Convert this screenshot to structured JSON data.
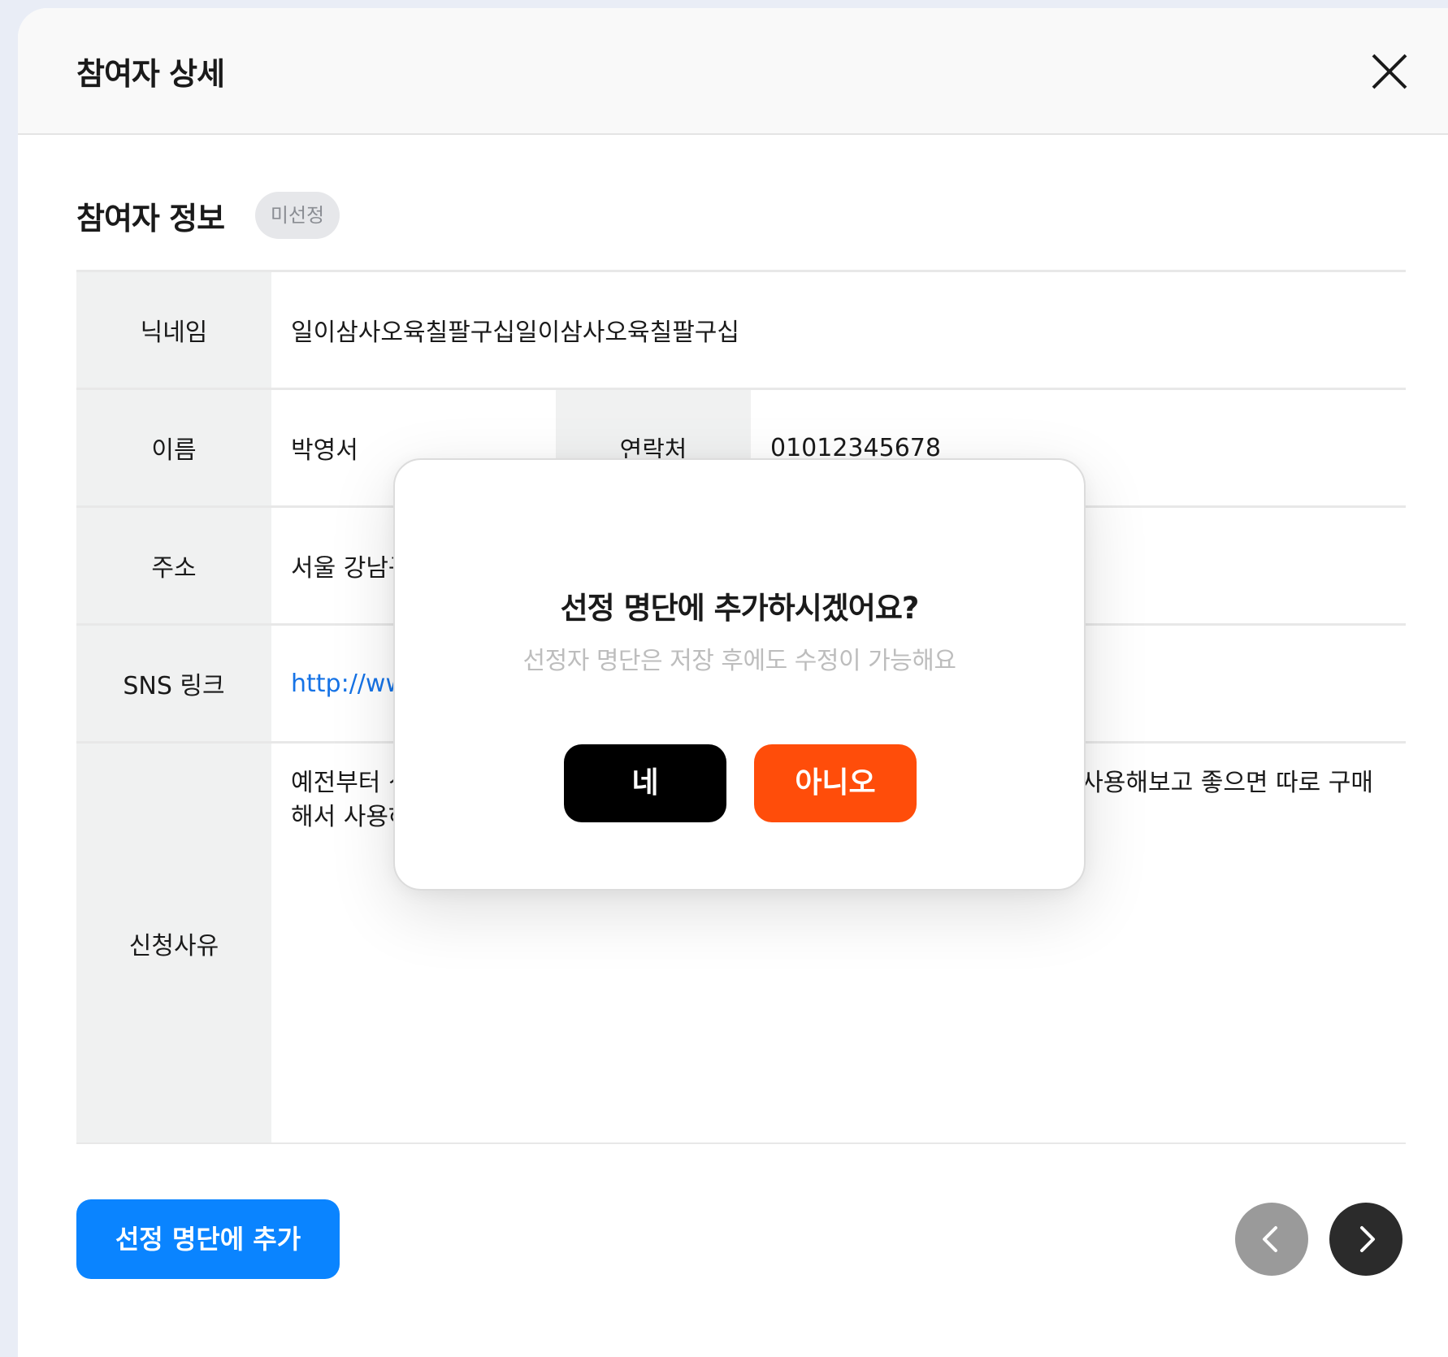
{
  "header": {
    "title": "참여자 상세",
    "close_icon": "close-icon"
  },
  "section": {
    "title": "참여자 정보",
    "status": "미선정"
  },
  "info": {
    "nickname_label": "닉네임",
    "nickname_value": "일이삼사오육칠팔구십일이삼사오육칠팔구십",
    "name_label": "이름",
    "name_value": "박영서",
    "contact_label": "연락처",
    "contact_value": "01012345678",
    "address_label": "주소",
    "address_value": "서울 강남구",
    "sns_label": "SNS 링크",
    "sns_value": "http://ww",
    "reason_label": "신청사유",
    "reason_line1_left": "예전부터 신",
    "reason_line1_right": "사용해보고 좋으면 따로 구매",
    "reason_line2": "해서 사용하"
  },
  "footer": {
    "add_button": "선정 명단에 추가",
    "prev_icon": "chevron-left-icon",
    "next_icon": "chevron-right-icon"
  },
  "modal": {
    "title": "선정 명단에 추가하시겠어요?",
    "subtitle": "선정자 명단은 저장 후에도 수정이 가능해요",
    "yes_button": "네",
    "no_button": "아니오"
  },
  "colors": {
    "primary": "#0a84ff",
    "danger": "#ff4d0a",
    "link": "#1673e6",
    "badge_bg": "#e6e7ea"
  }
}
